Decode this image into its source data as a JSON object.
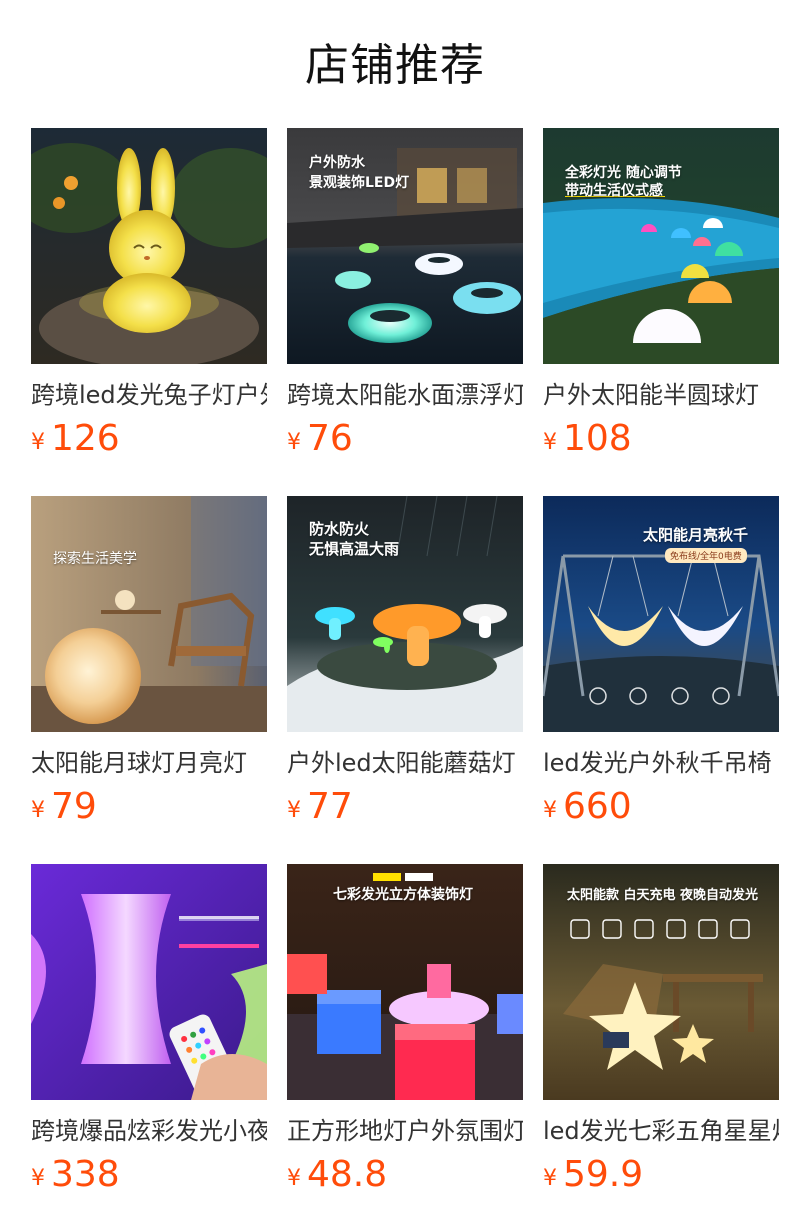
{
  "page": {
    "title": "店铺推荐"
  },
  "currency_symbol": "¥",
  "products": [
    {
      "name": "跨境led发光兔子灯户外庭院装饰灯",
      "price": "126",
      "image_icon": "rabbit-lamp-icon",
      "overlay": {
        "headline": "",
        "subline": "",
        "tag": ""
      }
    },
    {
      "name": "跨境太阳能水面漂浮灯",
      "price": "76",
      "image_icon": "floating-pool-lights-icon",
      "overlay": {
        "headline": "户外防水",
        "subline": "景观装饰LED灯",
        "tag": ""
      }
    },
    {
      "name": "户外太阳能半圆球灯",
      "price": "108",
      "image_icon": "half-sphere-lights-icon",
      "overlay": {
        "headline": "全彩灯光 随心调节",
        "subline": "带动生活仪式感",
        "tag": ""
      }
    },
    {
      "name": "太阳能月球灯月亮灯",
      "price": "79",
      "image_icon": "moon-ball-lamp-icon",
      "overlay": {
        "headline": "探索生活美学",
        "subline": "",
        "tag": ""
      }
    },
    {
      "name": "户外led太阳能蘑菇灯",
      "price": "77",
      "image_icon": "mushroom-lights-icon",
      "overlay": {
        "headline": "防水防火",
        "subline": "无惧高温大雨",
        "tag": ""
      }
    },
    {
      "name": "led发光户外秋千吊椅",
      "price": "660",
      "image_icon": "moon-swing-icon",
      "overlay": {
        "headline": "太阳能月亮秋千",
        "subline": "",
        "tag": "免布线/全年0电费"
      }
    },
    {
      "name": "跨境爆品炫彩发光小夜灯",
      "price": "338",
      "image_icon": "glowing-stool-remote-icon",
      "overlay": {
        "headline": "",
        "subline": "",
        "tag": ""
      }
    },
    {
      "name": "正方形地灯户外氛围灯",
      "price": "48.8",
      "image_icon": "cube-lights-icon",
      "overlay": {
        "headline": "七彩发光立方体装饰灯",
        "subline": "",
        "tag": ""
      }
    },
    {
      "name": "led发光七彩五角星星灯",
      "price": "59.9",
      "image_icon": "star-lamp-icon",
      "overlay": {
        "headline": "太阳能款 白天充电 夜晚自动发光",
        "subline": "",
        "tag": ""
      }
    }
  ],
  "colors": {
    "price": "#ff4c0a",
    "title": "#111111",
    "product_name": "#333333"
  }
}
